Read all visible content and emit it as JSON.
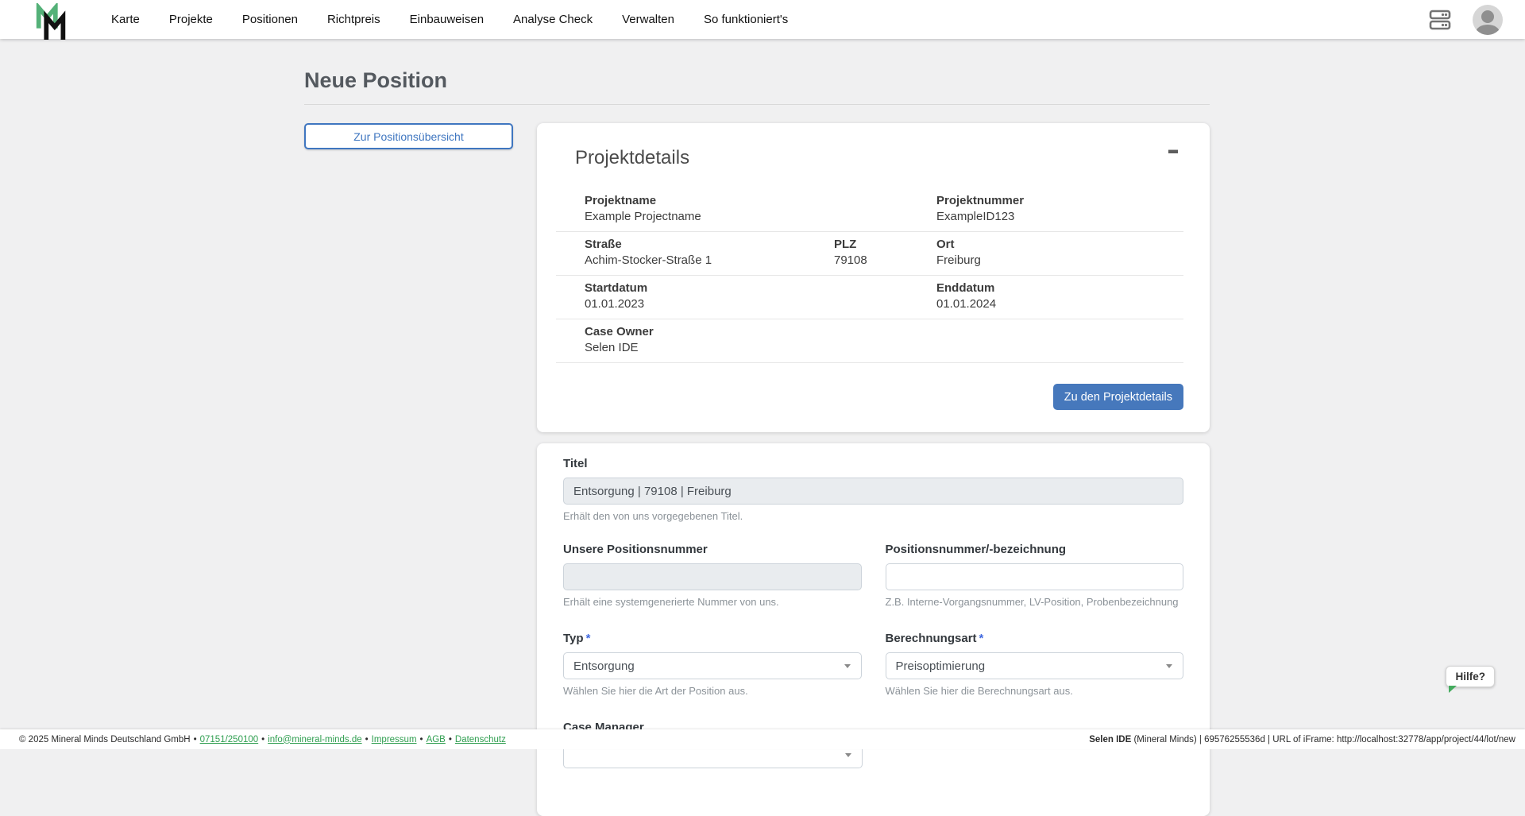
{
  "colors": {
    "accent_blue": "#4678BC",
    "outline_button_blue": "#3F76C0",
    "logo_green": "#54B178",
    "footer_link_green": "#2E9E4F",
    "required_asterisk_blue": "#4169E0",
    "help_tail_green": "#44AB5E"
  },
  "nav": {
    "items": [
      "Karte",
      "Projekte",
      "Positionen",
      "Richtpreis",
      "Einbauweisen",
      "Analyse Check",
      "Verwalten",
      "So funktioniert's"
    ],
    "right_icons": [
      "servers-icon",
      "user-avatar-icon"
    ]
  },
  "page": {
    "title": "Neue Position",
    "back_button_label": "Zur Positionsübersicht"
  },
  "project_card": {
    "title": "Projektdetails",
    "collapse_icon": "minus-icon",
    "fields": {
      "projektname": {
        "label": "Projektname",
        "value": "Example Projectname"
      },
      "projektnummer": {
        "label": "Projektnummer",
        "value": "ExampleID123"
      },
      "strasse": {
        "label": "Straße",
        "value": "Achim-Stocker-Straße 1"
      },
      "plz": {
        "label": "PLZ",
        "value": "79108"
      },
      "ort": {
        "label": "Ort",
        "value": "Freiburg"
      },
      "startdatum": {
        "label": "Startdatum",
        "value": "01.01.2023"
      },
      "enddatum": {
        "label": "Enddatum",
        "value": "01.01.2024"
      },
      "case_owner": {
        "label": "Case Owner",
        "value": "Selen IDE"
      }
    },
    "details_button_label": "Zu den Projektdetails"
  },
  "form": {
    "titel": {
      "label": "Titel",
      "value": "Entsorgung | 79108 | Freiburg",
      "helper": "Erhält den von uns vorgegebenen Titel."
    },
    "unsere_positionsnummer": {
      "label": "Unsere Positionsnummer",
      "value": "",
      "helper": "Erhält eine systemgenerierte Nummer von uns."
    },
    "positionsnummer_bezeichnung": {
      "label": "Positionsnummer/-bezeichnung",
      "value": "",
      "helper": "Z.B. Interne-Vorgangsnummer, LV-Position, Probenbezeichnung"
    },
    "typ": {
      "label": "Typ",
      "required_mark": "*",
      "value": "Entsorgung",
      "helper": "Wählen Sie hier die Art der Position aus."
    },
    "berechnungsart": {
      "label": "Berechnungsart",
      "required_mark": "*",
      "value": "Preisoptimierung",
      "helper": "Wählen Sie hier die Berechnungsart aus."
    },
    "case_manager": {
      "label": "Case Manager"
    }
  },
  "help": {
    "label": "Hilfe?"
  },
  "footer": {
    "left": {
      "copyright": "© 2025 Mineral Minds Deutschland GmbH",
      "separator": "•",
      "links": [
        "07151/250100",
        "info@mineral-minds.de",
        "Impressum",
        "AGB",
        "Datenschutz"
      ]
    },
    "right": {
      "bold": "Selen IDE",
      "rest": " (Mineral Minds) | 69576255536d | URL of iFrame: http://localhost:32778/app/project/44/lot/new"
    }
  }
}
